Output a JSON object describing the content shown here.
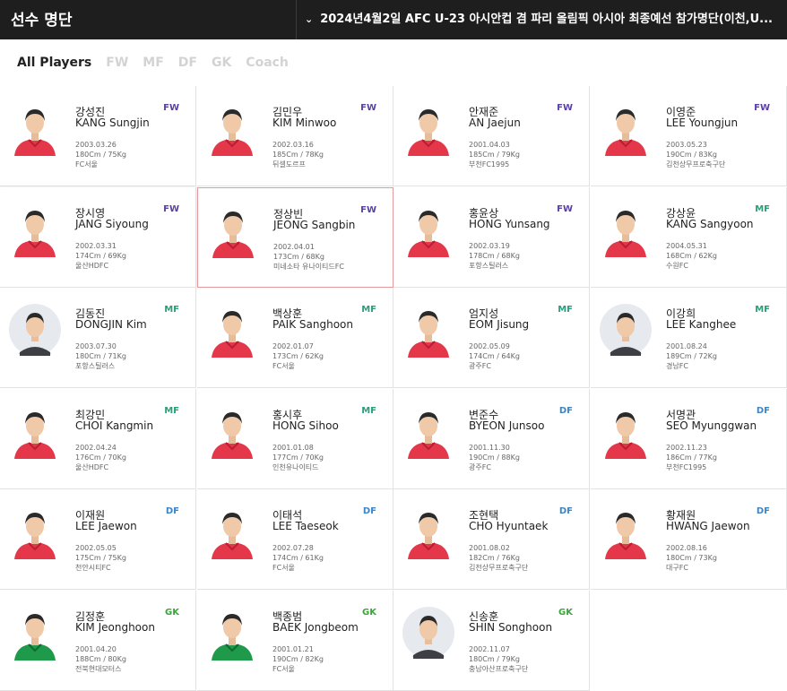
{
  "header": {
    "title": "선수 명단",
    "selector_label": "2024년4월2일 AFC U-23 아시안컵 겸 파리 올림픽 아시아 최종예선 참가명단(이천,U..."
  },
  "tabs": [
    {
      "label": "All Players",
      "active": true
    },
    {
      "label": "FW",
      "active": false
    },
    {
      "label": "MF",
      "active": false
    },
    {
      "label": "DF",
      "active": false
    },
    {
      "label": "GK",
      "active": false
    },
    {
      "label": "Coach",
      "active": false
    }
  ],
  "position_colors": {
    "FW": "#5a3fa6",
    "MF": "#2a9d7a",
    "DF": "#3b86c8",
    "GK": "#3aa53a"
  },
  "players": [
    {
      "kr": "강성진",
      "en": "KANG Sungjin",
      "pos": "FW",
      "dob": "2003.03.26",
      "hw": "180Cm / 75Kg",
      "club": "FC서울",
      "kit": "red"
    },
    {
      "kr": "김민우",
      "en": "KIM Minwoo",
      "pos": "FW",
      "dob": "2002.03.16",
      "hw": "185Cm / 78Kg",
      "club": "뒤셀도르프",
      "kit": "red"
    },
    {
      "kr": "안재준",
      "en": "AN Jaejun",
      "pos": "FW",
      "dob": "2001.04.03",
      "hw": "185Cm / 79Kg",
      "club": "부천FC1995",
      "kit": "red"
    },
    {
      "kr": "이영준",
      "en": "LEE Youngjun",
      "pos": "FW",
      "dob": "2003.05.23",
      "hw": "190Cm / 83Kg",
      "club": "김천상무프로축구단",
      "kit": "red"
    },
    {
      "kr": "장시영",
      "en": "JANG Siyoung",
      "pos": "FW",
      "dob": "2002.03.31",
      "hw": "174Cm / 69Kg",
      "club": "울산HDFC",
      "kit": "red"
    },
    {
      "kr": "정상빈",
      "en": "JEONG Sangbin",
      "pos": "FW",
      "dob": "2002.04.01",
      "hw": "173Cm / 68Kg",
      "club": "미네소타 유나이티드FC",
      "kit": "red"
    },
    {
      "kr": "홍윤상",
      "en": "HONG Yunsang",
      "pos": "FW",
      "dob": "2002.03.19",
      "hw": "178Cm / 68Kg",
      "club": "포항스틸러스",
      "kit": "red"
    },
    {
      "kr": "강상윤",
      "en": "KANG Sangyoon",
      "pos": "MF",
      "dob": "2004.05.31",
      "hw": "168Cm / 62Kg",
      "club": "수원FC",
      "kit": "red"
    },
    {
      "kr": "김동진",
      "en": "DONGJIN Kim",
      "pos": "MF",
      "dob": "2003.07.30",
      "hw": "180Cm / 71Kg",
      "club": "포항스틸러스",
      "kit": "circle"
    },
    {
      "kr": "백상훈",
      "en": "PAIK Sanghoon",
      "pos": "MF",
      "dob": "2002.01.07",
      "hw": "173Cm / 62Kg",
      "club": "FC서울",
      "kit": "red"
    },
    {
      "kr": "엄지성",
      "en": "EOM Jisung",
      "pos": "MF",
      "dob": "2002.05.09",
      "hw": "174Cm / 64Kg",
      "club": "광주FC",
      "kit": "red"
    },
    {
      "kr": "이강희",
      "en": "LEE Kanghee",
      "pos": "MF",
      "dob": "2001.08.24",
      "hw": "189Cm / 72Kg",
      "club": "경남FC",
      "kit": "circle"
    },
    {
      "kr": "최강민",
      "en": "CHOI Kangmin",
      "pos": "MF",
      "dob": "2002.04.24",
      "hw": "176Cm / 70Kg",
      "club": "울산HDFC",
      "kit": "red"
    },
    {
      "kr": "홍시후",
      "en": "HONG Sihoo",
      "pos": "MF",
      "dob": "2001.01.08",
      "hw": "177Cm / 70Kg",
      "club": "인천유나이티드",
      "kit": "red"
    },
    {
      "kr": "변준수",
      "en": "BYEON Junsoo",
      "pos": "DF",
      "dob": "2001.11.30",
      "hw": "190Cm / 88Kg",
      "club": "광주FC",
      "kit": "red"
    },
    {
      "kr": "서명관",
      "en": "SEO Myunggwan",
      "pos": "DF",
      "dob": "2002.11.23",
      "hw": "186Cm / 77Kg",
      "club": "부천FC1995",
      "kit": "red"
    },
    {
      "kr": "이재원",
      "en": "LEE Jaewon",
      "pos": "DF",
      "dob": "2002.05.05",
      "hw": "175Cm / 75Kg",
      "club": "천안시티FC",
      "kit": "red"
    },
    {
      "kr": "이태석",
      "en": "LEE Taeseok",
      "pos": "DF",
      "dob": "2002.07.28",
      "hw": "174Cm / 61Kg",
      "club": "FC서울",
      "kit": "red"
    },
    {
      "kr": "조현택",
      "en": "CHO Hyuntaek",
      "pos": "DF",
      "dob": "2001.08.02",
      "hw": "182Cm / 76Kg",
      "club": "김천상무프로축구단",
      "kit": "red"
    },
    {
      "kr": "황재원",
      "en": "HWANG Jaewon",
      "pos": "DF",
      "dob": "2002.08.16",
      "hw": "180Cm / 73Kg",
      "club": "대구FC",
      "kit": "red"
    },
    {
      "kr": "김정훈",
      "en": "KIM Jeonghoon",
      "pos": "GK",
      "dob": "2001.04.20",
      "hw": "188Cm / 80Kg",
      "club": "전북현대모터스",
      "kit": "green"
    },
    {
      "kr": "백종범",
      "en": "BAEK Jongbeom",
      "pos": "GK",
      "dob": "2001.01.21",
      "hw": "190Cm / 82Kg",
      "club": "FC서울",
      "kit": "green"
    },
    {
      "kr": "신송훈",
      "en": "SHIN Songhoon",
      "pos": "GK",
      "dob": "2002.11.07",
      "hw": "180Cm / 79Kg",
      "club": "충남아산프로축구단",
      "kit": "circle"
    }
  ]
}
